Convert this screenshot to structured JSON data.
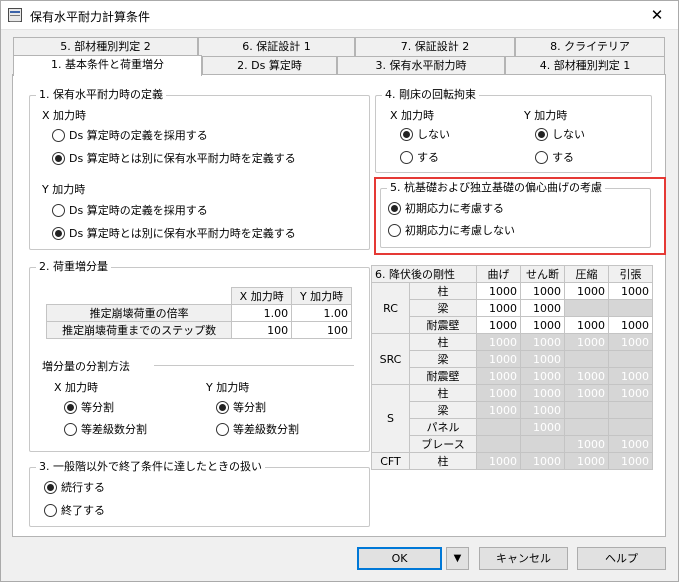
{
  "window": {
    "title": "保有水平耐力計算条件",
    "close_glyph": "✕"
  },
  "tabs": {
    "row1": [
      "5. 部材種別判定 2",
      "6. 保証設計 1",
      "7. 保証設計 2",
      "8. クライテリア"
    ],
    "row2": [
      "1. 基本条件と荷重増分",
      "2. Ds 算定時",
      "3. 保有水平耐力時",
      "4. 部材種別判定 1"
    ]
  },
  "g1": {
    "legend": "1. 保有水平耐力時の定義",
    "x_label": "X 加力時",
    "x_opt1": "Ds 算定時の定義を採用する",
    "x_opt2": "Ds 算定時とは別に保有水平耐力時を定義する",
    "y_label": "Y 加力時",
    "y_opt1": "Ds 算定時の定義を採用する",
    "y_opt2": "Ds 算定時とは別に保有水平耐力時を定義する"
  },
  "g2": {
    "legend": "2. 荷重増分量",
    "col_x": "X 加力時",
    "col_y": "Y 加力時",
    "row1_label": "推定崩壊荷重の倍率",
    "row1_x": "1.00",
    "row1_y": "1.00",
    "row2_label": "推定崩壊荷重までのステップ数",
    "row2_x": "100",
    "row2_y": "100",
    "method_label": "増分量の分割方法",
    "x_label": "X 加力時",
    "x_opt1": "等分割",
    "x_opt2": "等差級数分割",
    "y_label": "Y 加力時",
    "y_opt1": "等分割",
    "y_opt2": "等差級数分割"
  },
  "g3": {
    "legend": "3. 一般階以外で終了条件に達したときの扱い",
    "opt1": "続行する",
    "opt2": "終了する"
  },
  "g4": {
    "legend": "4. 剛床の回転拘束",
    "x_label": "X 加力時",
    "y_label": "Y 加力時",
    "opt_no": "しない",
    "opt_yes": "する"
  },
  "g5": {
    "legend": "5. 杭基礎および独立基礎の偏心曲げの考慮",
    "opt1": "初期応力に考慮する",
    "opt2": "初期応力に考慮しない"
  },
  "g6": {
    "title": "6. 降伏後の剛性",
    "cols": [
      "曲げ",
      "せん断",
      "圧縮",
      "引張"
    ],
    "rc": "RC",
    "src": "SRC",
    "s": "S",
    "cft": "CFT",
    "col_member": "柱",
    "beam": "梁",
    "wall": "耐震壁",
    "panel": "パネル",
    "brace": "ブレース",
    "v": "1000"
  },
  "buttons": {
    "ok": "OK",
    "dropdown": "▼",
    "cancel": "キャンセル",
    "help": "ヘルプ"
  }
}
